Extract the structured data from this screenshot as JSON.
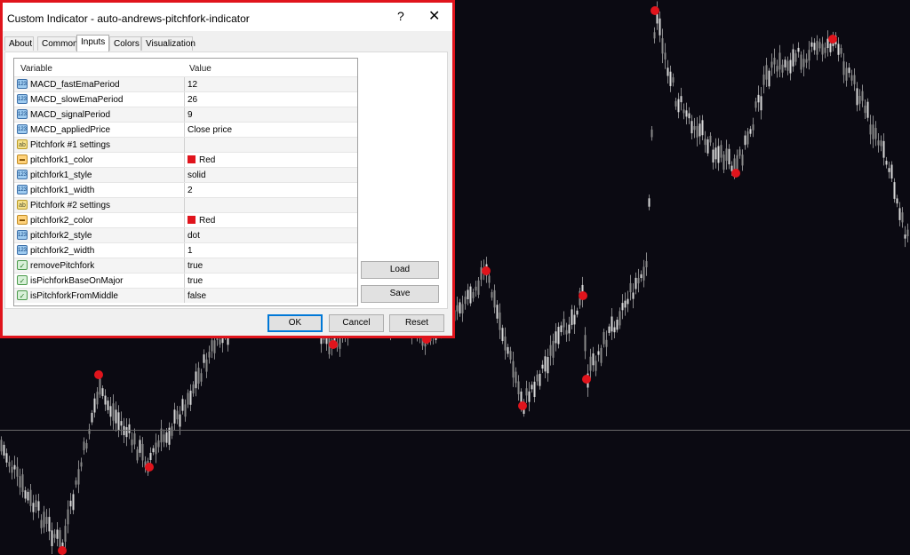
{
  "dialog": {
    "title": "Custom Indicator - auto-andrews-pitchfork-indicator",
    "help_symbol": "?",
    "close_symbol": "✕",
    "tabs": [
      "About",
      "Common",
      "Inputs",
      "Colors",
      "Visualization"
    ],
    "active_tab": "Inputs",
    "grid": {
      "headers": [
        "Variable",
        "Value"
      ],
      "rows": [
        {
          "name": "MACD_fastEmaPeriod",
          "value": "12",
          "icon": "int-icon"
        },
        {
          "name": "MACD_slowEmaPeriod",
          "value": "26",
          "icon": "int-icon"
        },
        {
          "name": "MACD_signalPeriod",
          "value": "9",
          "icon": "int-icon"
        },
        {
          "name": "MACD_appliedPrice",
          "value": "Close price",
          "icon": "int-icon"
        },
        {
          "name": "Pitchfork #1 settings",
          "value": "",
          "icon": "string-icon"
        },
        {
          "name": "pitchfork1_color",
          "value": "Red",
          "icon": "color-icon",
          "swatch": "#e0141c"
        },
        {
          "name": "pitchfork1_style",
          "value": "solid",
          "icon": "int-icon"
        },
        {
          "name": "pitchfork1_width",
          "value": "2",
          "icon": "int-icon"
        },
        {
          "name": "Pitchfork #2 settings",
          "value": "",
          "icon": "string-icon"
        },
        {
          "name": "pitchfork2_color",
          "value": "Red",
          "icon": "color-icon",
          "swatch": "#e0141c"
        },
        {
          "name": "pitchfork2_style",
          "value": "dot",
          "icon": "int-icon"
        },
        {
          "name": "pitchfork2_width",
          "value": "1",
          "icon": "int-icon"
        },
        {
          "name": "removePitchfork",
          "value": "true",
          "icon": "bool-icon"
        },
        {
          "name": "isPichforkBaseOnMajor",
          "value": "true",
          "icon": "bool-icon"
        },
        {
          "name": "isPitchforkFromMiddle",
          "value": "false",
          "icon": "bool-icon"
        }
      ]
    },
    "buttons": {
      "load": "Load",
      "save": "Save",
      "ok": "OK",
      "cancel": "Cancel",
      "reset": "Reset"
    }
  },
  "chart": {
    "background": "#0b0a12",
    "candle_color": "#d9d9d9",
    "marker_color": "#e0141c",
    "price_level_line_color": "#6a6a6a"
  }
}
